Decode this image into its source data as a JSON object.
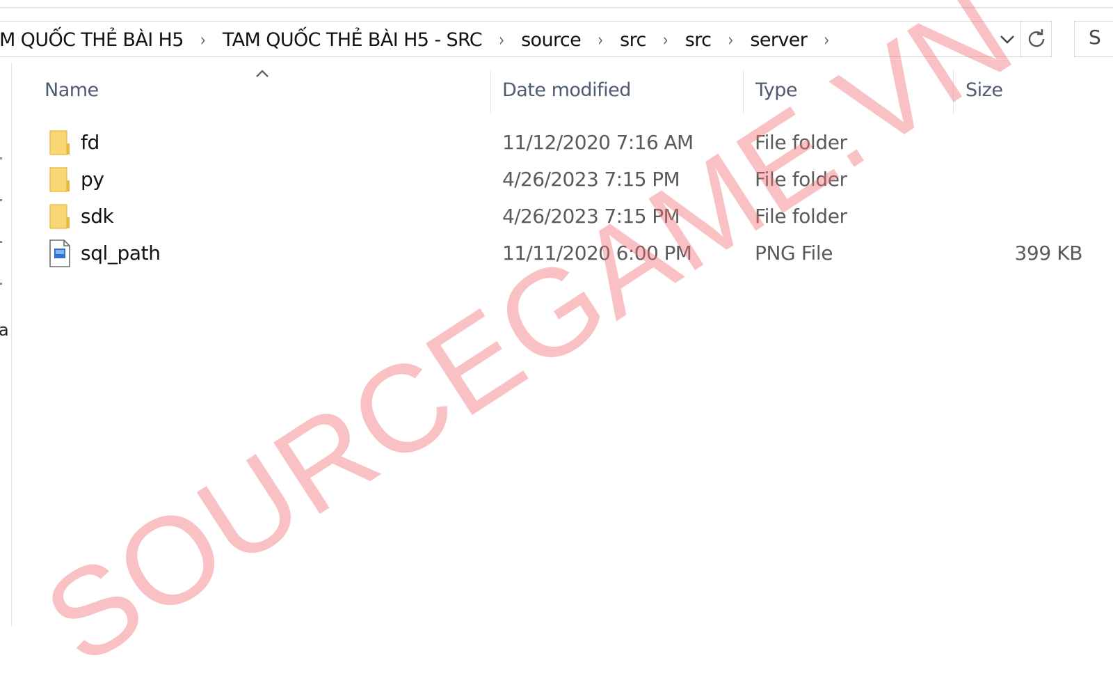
{
  "breadcrumb": {
    "items": [
      "M QUỐC THẺ BÀI H5",
      "TAM QUỐC THẺ BÀI H5 - SRC",
      "source",
      "src",
      "src",
      "server"
    ]
  },
  "columns": {
    "name": "Name",
    "date_modified": "Date modified",
    "type": "Type",
    "size": "Size"
  },
  "files": [
    {
      "name": "fd",
      "date": "11/12/2020 7:16 AM",
      "type": "File folder",
      "size": "",
      "icon": "folder-icon"
    },
    {
      "name": "py",
      "date": "4/26/2023 7:15 PM",
      "type": "File folder",
      "size": "",
      "icon": "folder-icon"
    },
    {
      "name": "sdk",
      "date": "4/26/2023 7:15 PM",
      "type": "File folder",
      "size": "",
      "icon": "folder-icon"
    },
    {
      "name": "sql_path",
      "date": "11/11/2020 6:00 PM",
      "type": "PNG File",
      "size": "399 KB",
      "icon": "png-file-icon"
    }
  ],
  "nav_pane": {
    "partial_letter": "a"
  },
  "watermark": "SOURCEGAME.VN",
  "colors": {
    "folder": "#f8d774",
    "folder_dark": "#e7b93c",
    "header_text": "#4e5a70",
    "watermark": "#f16c70"
  }
}
